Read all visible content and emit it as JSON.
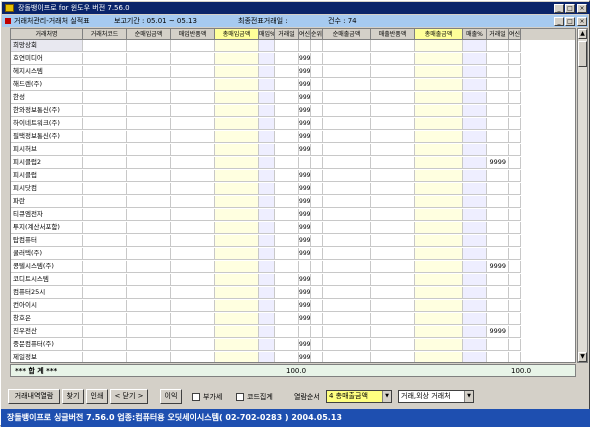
{
  "window": {
    "title": "장돌뱅이프로 for 윈도우 버전 7.56.0",
    "min_icon": "minimize-icon",
    "max_icon": "maximize-icon",
    "close_icon": "close-icon"
  },
  "child": {
    "title": "거래처관리-거래처 실적표",
    "period": "보고기간 : 05.01 ~ 05.13",
    "final_partner": "최종전표거래일 :",
    "count": "건수 : 74"
  },
  "columns": [
    "거래처명",
    "거래처코드",
    "순매입금액",
    "매입반품액",
    "총매입금액",
    "매입%",
    "거래일",
    "여신",
    "순위",
    "순매출금액",
    "매출반품액",
    "총매출금액",
    "매출%",
    "거래일",
    "여신"
  ],
  "rows": [
    {
      "name": "희망상회",
      "credit": "",
      "extra": ""
    },
    {
      "name": "호연미디어",
      "credit": "99999",
      "extra": ""
    },
    {
      "name": "헤지시스템",
      "credit": "99999",
      "extra": ""
    },
    {
      "name": "해드렌(주)",
      "credit": "99999",
      "extra": ""
    },
    {
      "name": "한성",
      "credit": "99999",
      "extra": ""
    },
    {
      "name": "한와정보통신(주)",
      "credit": "99999",
      "extra": ""
    },
    {
      "name": "하이네트워크(주)",
      "credit": "99999",
      "extra": ""
    },
    {
      "name": "필택정보통신(주)",
      "credit": "99999",
      "extra": ""
    },
    {
      "name": "피시허브",
      "credit": "99999",
      "extra": ""
    },
    {
      "name": "피시클럽2",
      "credit": "",
      "extra": "9999"
    },
    {
      "name": "피시클럽",
      "credit": "99999",
      "extra": ""
    },
    {
      "name": "피시닷컴",
      "credit": "99999",
      "extra": ""
    },
    {
      "name": "파란",
      "credit": "99999",
      "extra": ""
    },
    {
      "name": "티큐엠전자",
      "credit": "99999",
      "extra": ""
    },
    {
      "name": "투지(계산서포함)",
      "credit": "99999",
      "extra": ""
    },
    {
      "name": "탑컴퓨터",
      "credit": "99999",
      "extra": ""
    },
    {
      "name": "쿨러텍(주)",
      "credit": "99999",
      "extra": ""
    },
    {
      "name": "콩텔시스템(주)",
      "credit": "",
      "extra": "9999"
    },
    {
      "name": "코디트시스템",
      "credit": "99999",
      "extra": ""
    },
    {
      "name": "컴퓨터25시",
      "credit": "99999",
      "extra": ""
    },
    {
      "name": "컨아이시",
      "credit": "99999",
      "extra": ""
    },
    {
      "name": "창호은",
      "credit": "99999",
      "extra": ""
    },
    {
      "name": "진우전산",
      "credit": "",
      "extra": "9999"
    },
    {
      "name": "중문컴퓨터(주)",
      "credit": "99999",
      "extra": ""
    },
    {
      "name": "제일정보",
      "credit": "99999",
      "extra": ""
    }
  ],
  "totals": {
    "label": "*** 합 계 ***",
    "buy_pct": "100.0",
    "sale_pct": "100.0"
  },
  "toolbar": {
    "detail": "거래내역열람",
    "find": "찾기",
    "print": "인쇄",
    "close": "< 닫기 >",
    "reload": "이익",
    "vat": "부가세",
    "code_sum": "코드집계",
    "sort_label": "열람순서",
    "sort_value": "4 총매출금액",
    "filter_value": "거래,외상 거래처"
  },
  "status": "장돌뱅이프로 싱글버전 7.56.0    업종:컴퓨터용  오딧세이시스템( 02-702-0283 )    2004.05.13"
}
